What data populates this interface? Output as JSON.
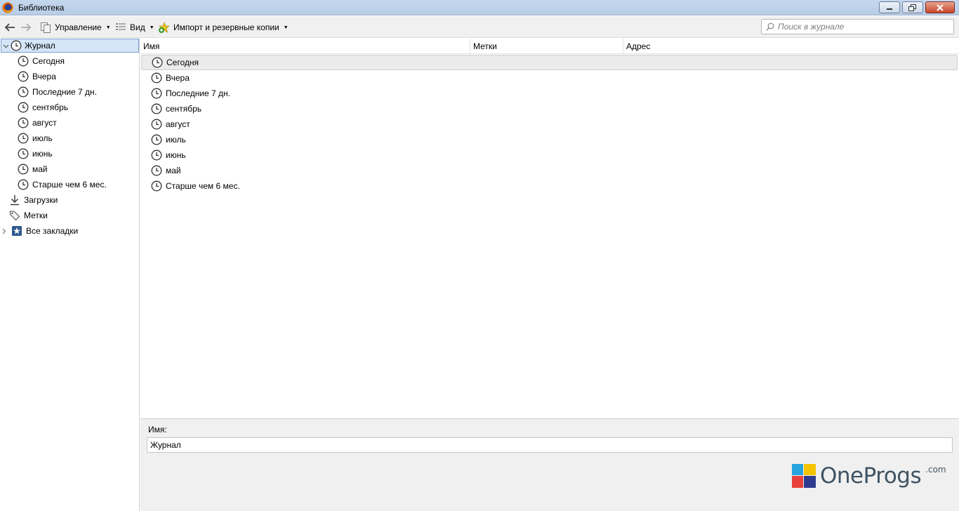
{
  "window": {
    "title": "Библиотека",
    "controls": [
      "minimize",
      "restore",
      "close"
    ]
  },
  "toolbar": {
    "organize_label": "Управление",
    "view_label": "Вид",
    "import_label": "Импорт и резервные копии",
    "search_placeholder": "Поиск в журнале"
  },
  "sidebar": {
    "items": [
      {
        "label": "Журнал",
        "icon": "clock-icon",
        "selected": true,
        "expanded": true
      },
      {
        "label": "Сегодня",
        "icon": "clock-icon"
      },
      {
        "label": "Вчера",
        "icon": "clock-icon"
      },
      {
        "label": "Последние 7 дн.",
        "icon": "clock-icon"
      },
      {
        "label": "сентябрь",
        "icon": "clock-icon"
      },
      {
        "label": "август",
        "icon": "clock-icon"
      },
      {
        "label": "июль",
        "icon": "clock-icon"
      },
      {
        "label": "июнь",
        "icon": "clock-icon"
      },
      {
        "label": "май",
        "icon": "clock-icon"
      },
      {
        "label": "Старше чем 6 мес.",
        "icon": "clock-icon"
      },
      {
        "label": "Загрузки",
        "icon": "download-icon"
      },
      {
        "label": "Метки",
        "icon": "tag-icon"
      },
      {
        "label": "Все закладки",
        "icon": "bookmarks-star-icon",
        "collapsed": true
      }
    ]
  },
  "columns": [
    "Имя",
    "Метки",
    "Адрес"
  ],
  "list": {
    "rows": [
      {
        "name": "Сегодня",
        "selected": true
      },
      {
        "name": "Вчера"
      },
      {
        "name": "Последние 7 дн."
      },
      {
        "name": "сентябрь"
      },
      {
        "name": "август"
      },
      {
        "name": "июль"
      },
      {
        "name": "июнь"
      },
      {
        "name": "май"
      },
      {
        "name": "Старше чем 6 мес."
      }
    ]
  },
  "details": {
    "name_label": "Имя:",
    "name_value": "Журнал"
  },
  "watermark": {
    "text": "OneProgs",
    "suffix": ".com"
  }
}
